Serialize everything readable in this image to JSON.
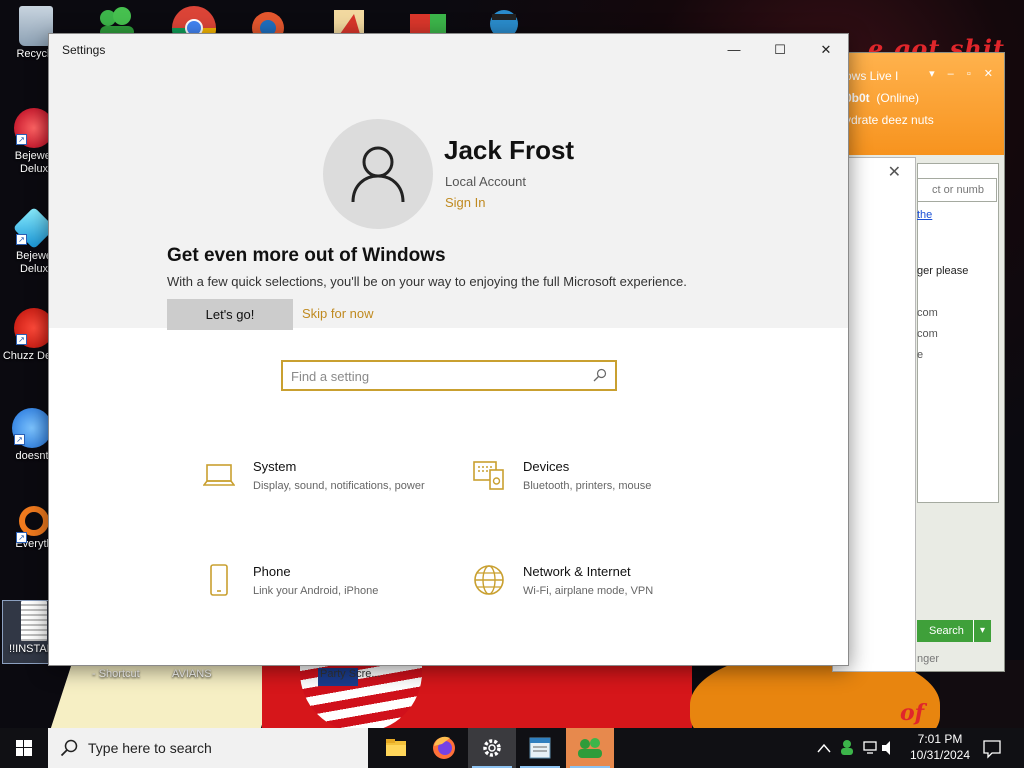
{
  "desktop": {
    "icons": [
      {
        "label": "Recycle"
      },
      {
        "label": "Bejewel Delux"
      },
      {
        "label": "Bejewe Delux"
      },
      {
        "label": "Chuzz Delux"
      },
      {
        "label": "doesnt"
      },
      {
        "label": "Everyth"
      },
      {
        "label": "!!INSTALL"
      }
    ],
    "bottom_labels": [
      "- Shortcut",
      "AVIANS",
      "Party Scre..."
    ],
    "graffiti": [
      "e got shit",
      "of"
    ]
  },
  "messenger": {
    "title": "ows Live I",
    "status_name": "0b0t",
    "status": "(Online)",
    "message": "ydrate deez nuts",
    "search_placeholder": "ct or numb",
    "link_text": "the",
    "lines": [
      "ger please",
      "com",
      "com",
      "e"
    ],
    "search_button": "Search",
    "footer": "nger"
  },
  "settings": {
    "window_title": "Settings",
    "controls": {
      "minimize": "—",
      "maximize": "☐",
      "close": "✕"
    },
    "user": {
      "name": "Jack Frost",
      "account_type": "Local Account",
      "sign_in": "Sign In"
    },
    "promo": {
      "title": "Get even more out of Windows",
      "text": "With a few quick selections, you'll be on your way to enjoying the full Microsoft experience.",
      "primary_button": "Let's go!",
      "secondary_link": "Skip for now"
    },
    "search": {
      "placeholder": "Find a setting"
    },
    "categories": [
      {
        "name": "System",
        "desc": "Display, sound, notifications, power",
        "icon": "laptop-icon"
      },
      {
        "name": "Devices",
        "desc": "Bluetooth, printers, mouse",
        "icon": "devices-icon"
      },
      {
        "name": "Phone",
        "desc": "Link your Android, iPhone",
        "icon": "phone-icon"
      },
      {
        "name": "Network & Internet",
        "desc": "Wi-Fi, airplane mode, VPN",
        "icon": "globe-icon"
      }
    ],
    "accent": "#c9a030"
  },
  "taskbar": {
    "search_label": "Type here to search",
    "apps": [
      "file-explorer-icon",
      "firefox-icon",
      "settings-gear-icon",
      "notepad-icon",
      "messenger-icon"
    ],
    "time": "7:01 PM",
    "date": "10/31/2024"
  }
}
